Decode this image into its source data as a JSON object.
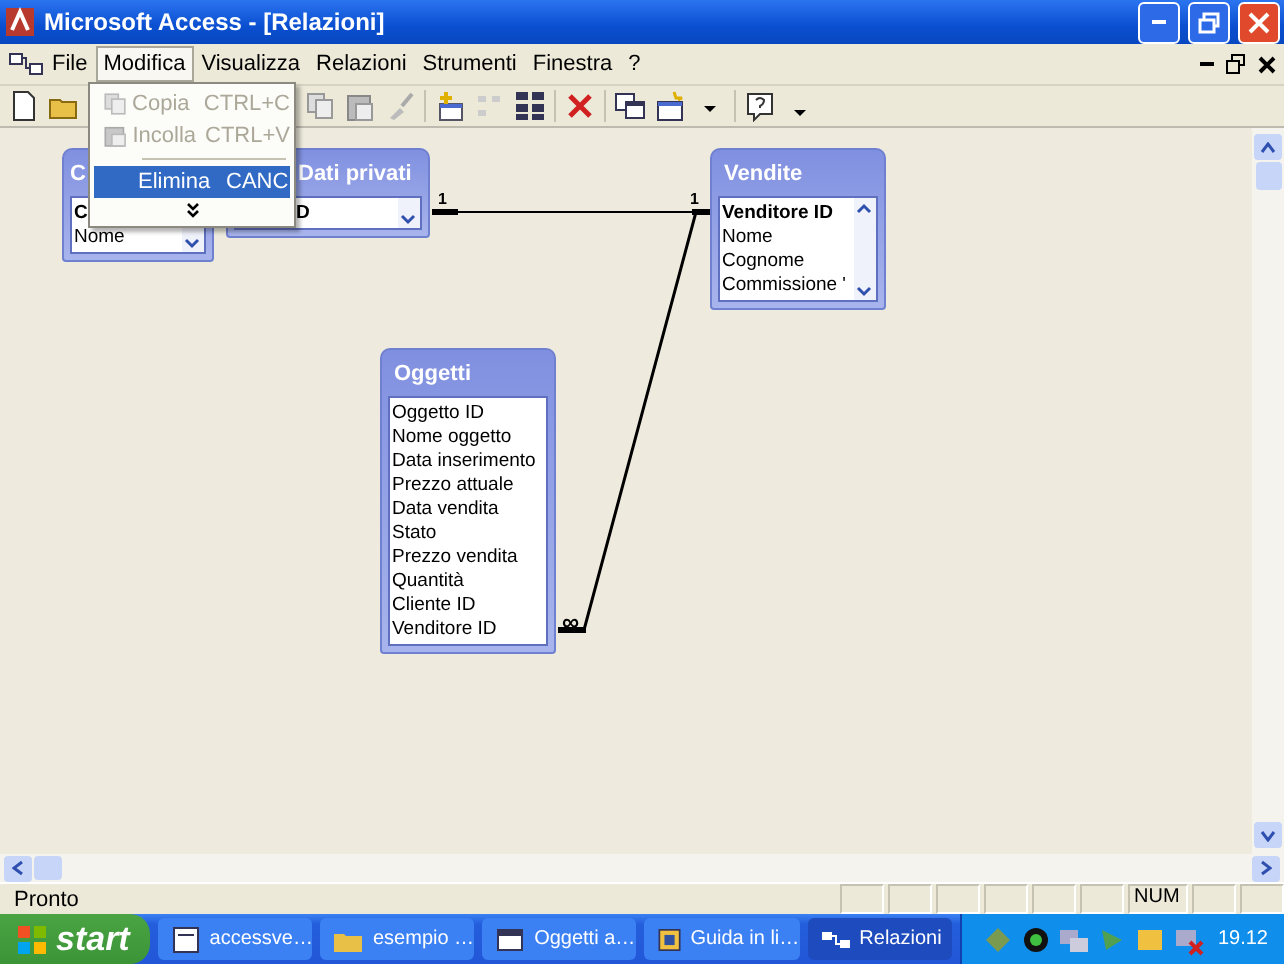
{
  "window": {
    "title": "Microsoft Access - [Relazioni]"
  },
  "menu_bar": [
    {
      "label": "File",
      "selected": false
    },
    {
      "label": "Modifica",
      "selected": true
    },
    {
      "label": "Visualizza",
      "selected": false
    },
    {
      "label": "Relazioni",
      "selected": false
    },
    {
      "label": "Strumenti",
      "selected": false
    },
    {
      "label": "Finestra",
      "selected": false
    },
    {
      "label": "?",
      "selected": false
    }
  ],
  "edit_menu": [
    {
      "kind": "item",
      "label": "Copia",
      "shortcut": "CTRL+C",
      "disabled": true,
      "selected": false
    },
    {
      "kind": "item",
      "label": "Incolla",
      "shortcut": "CTRL+V",
      "disabled": true,
      "selected": false
    },
    {
      "kind": "separator"
    },
    {
      "kind": "item",
      "label": "Elimina",
      "shortcut": "CANC",
      "disabled": false,
      "selected": true
    },
    {
      "kind": "expand"
    }
  ],
  "tables": [
    {
      "title": "C",
      "scrollable": true,
      "fields": [
        {
          "name": "C",
          "primary": true
        },
        {
          "name": "Nome",
          "primary": false
        }
      ]
    },
    {
      "title": "Dati privati",
      "scrollable": true,
      "fields": [
        {
          "name": "D",
          "primary": true
        }
      ]
    },
    {
      "title": "Vendite",
      "scrollable": true,
      "fields": [
        {
          "name": "Venditore ID",
          "primary": true
        },
        {
          "name": "Nome",
          "primary": false
        },
        {
          "name": "Cognome",
          "primary": false
        },
        {
          "name": "Commissione '",
          "primary": false
        }
      ]
    },
    {
      "title": "Oggetti",
      "scrollable": false,
      "fields": [
        {
          "name": "Oggetto ID",
          "primary": false
        },
        {
          "name": "Nome oggetto",
          "primary": false
        },
        {
          "name": "Data inserimento",
          "primary": false
        },
        {
          "name": "Prezzo attuale",
          "primary": false
        },
        {
          "name": "Data vendita",
          "primary": false
        },
        {
          "name": "Stato",
          "primary": false
        },
        {
          "name": "Prezzo vendita",
          "primary": false
        },
        {
          "name": "Quantità",
          "primary": false
        },
        {
          "name": "Cliente ID",
          "primary": false
        },
        {
          "name": "Venditore ID",
          "primary": false
        }
      ]
    }
  ],
  "relationships": [
    {
      "start_label": "1"
    },
    {
      "start_label": "1",
      "end_label": "∞"
    }
  ],
  "status_bar": {
    "text": "Pronto",
    "indicator": "NUM"
  },
  "taskbar": {
    "start": "start",
    "buttons": [
      {
        "label": "accessve…",
        "selected": false
      },
      {
        "label": "esempio …",
        "selected": false
      },
      {
        "label": "Oggetti a…",
        "selected": false
      },
      {
        "label": "Guida in li…",
        "selected": false
      },
      {
        "label": "Relazioni",
        "selected": true
      }
    ],
    "clock": "19.12"
  }
}
